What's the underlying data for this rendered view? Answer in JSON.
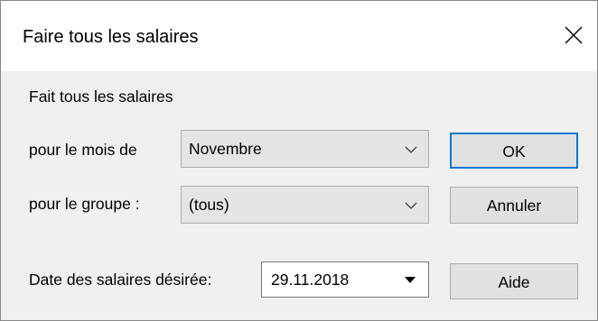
{
  "window": {
    "title": "Faire tous les salaires"
  },
  "main": {
    "heading": "Fait tous les salaires",
    "month_label": "pour le mois de",
    "month_value": "Novembre",
    "group_label": "pour le groupe :",
    "group_value": "(tous)",
    "date_label": "Date des salaires désirée:",
    "date_value": "29.11.2018"
  },
  "buttons": {
    "ok": "OK",
    "cancel": "Annuler",
    "help": "Aide"
  },
  "icons": {
    "close": "close-icon",
    "month_dropdown": "chevron-down-icon",
    "group_dropdown": "chevron-down-icon",
    "date_dropdown": "dropdown-arrow-icon"
  },
  "colors": {
    "default_button_border": "#0078d7",
    "dialog_background": "#f0f0f0",
    "titlebar_background": "#ffffff"
  }
}
